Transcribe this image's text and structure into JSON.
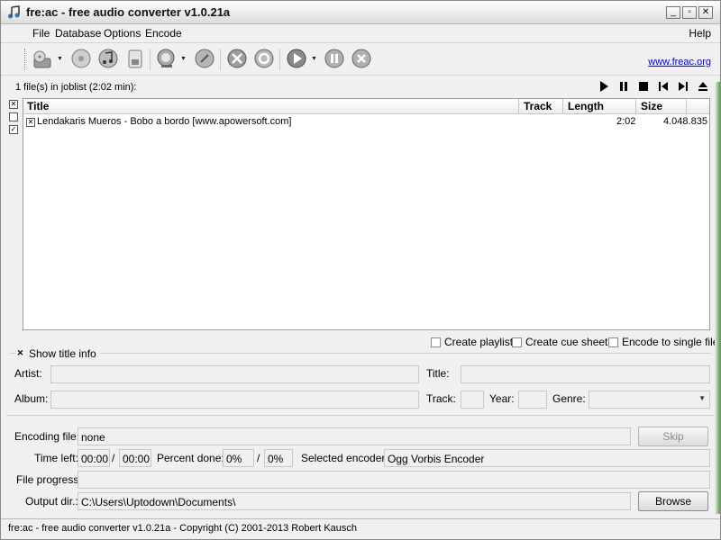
{
  "window": {
    "title": "fre:ac - free audio converter v1.0.21a"
  },
  "menu": {
    "items": [
      "File",
      "Database",
      "Options",
      "Encode"
    ],
    "help": "Help"
  },
  "toolbar": {
    "buttons": [
      "add-files",
      "add-cd",
      "cddb",
      "cddb-edit",
      "cddb-query",
      "cddb-submit",
      "configure",
      "settings",
      "encode",
      "pause",
      "stop"
    ],
    "link": "www.freac.org"
  },
  "joblist": {
    "summary": "1 file(s) in joblist (2:02 min):",
    "columns": {
      "title": "Title",
      "track": "Track",
      "length": "Length",
      "size": "Size"
    },
    "rows": [
      {
        "title": "Lendakaris Mueros - Bobo a bordo [www.apowersoft.com]",
        "track": "",
        "length": "2:02",
        "size": "4.048.835"
      }
    ]
  },
  "list_options": {
    "create_playlist": "Create playlist",
    "create_cue_sheet": "Create cue sheet",
    "encode_single": "Encode to single file"
  },
  "title_info": {
    "show_label": "Show title info",
    "artist_label": "Artist:",
    "title_label": "Title:",
    "album_label": "Album:",
    "track_label": "Track:",
    "year_label": "Year:",
    "genre_label": "Genre:"
  },
  "encoding": {
    "file_label": "Encoding file:",
    "file_value": "none",
    "skip": "Skip",
    "time_left_label": "Time left:",
    "time_left": "00:00",
    "time_sep": "/",
    "time_total": "00:00",
    "percent_label": "Percent done:",
    "percent": "0%",
    "percent_sep": "/",
    "percent_total": "0%",
    "encoder_label": "Selected encoder:",
    "encoder": "Ogg Vorbis Encoder",
    "progress_label": "File progress:",
    "output_label": "Output dir.:",
    "output": "C:\\Users\\Uptodown\\Documents\\",
    "browse": "Browse"
  },
  "status": {
    "text": "fre:ac - free audio converter v1.0.21a - Copyright (C) 2001-2013 Robert Kausch"
  },
  "colors": {
    "link": "#0000cc",
    "desktop": "#6f9e5c"
  }
}
